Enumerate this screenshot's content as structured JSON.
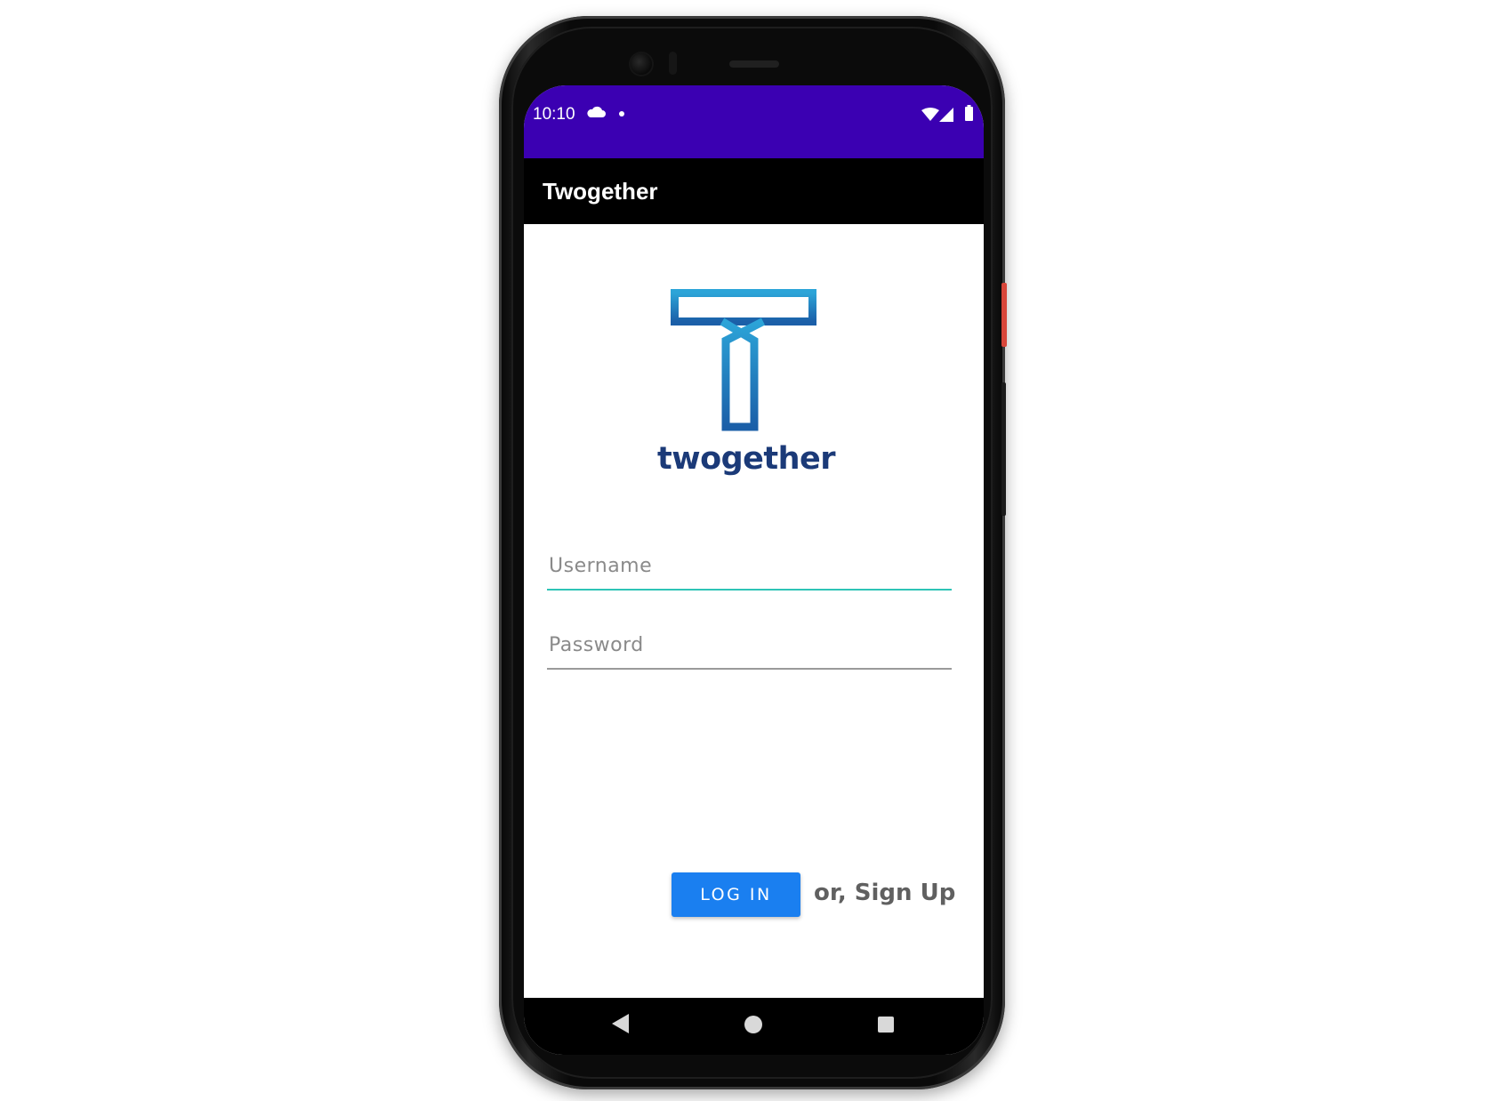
{
  "status_bar": {
    "time": "10:10",
    "icons": [
      "cloud-icon",
      "notification-dot-icon",
      "wifi-icon",
      "signal-icon",
      "battery-icon"
    ],
    "background_color": "#3b00b2"
  },
  "app_bar": {
    "title": "Twogether",
    "background_color": "#000000"
  },
  "logo": {
    "icon": "twogether-t-logo-icon",
    "wordmark": "twogether",
    "colors": [
      "#2ca4d8",
      "#1b5fa8",
      "#1b3a78"
    ]
  },
  "form": {
    "username_placeholder": "Username",
    "password_placeholder": "Password",
    "username_value": "",
    "password_value": "",
    "focused_underline_color": "#2ec4b6"
  },
  "actions": {
    "login_label": "LOG IN",
    "signup_label": "or, Sign Up",
    "login_color": "#1a7ff0"
  },
  "nav_bar": {
    "icons": [
      "back-icon",
      "home-icon",
      "recents-icon"
    ]
  }
}
